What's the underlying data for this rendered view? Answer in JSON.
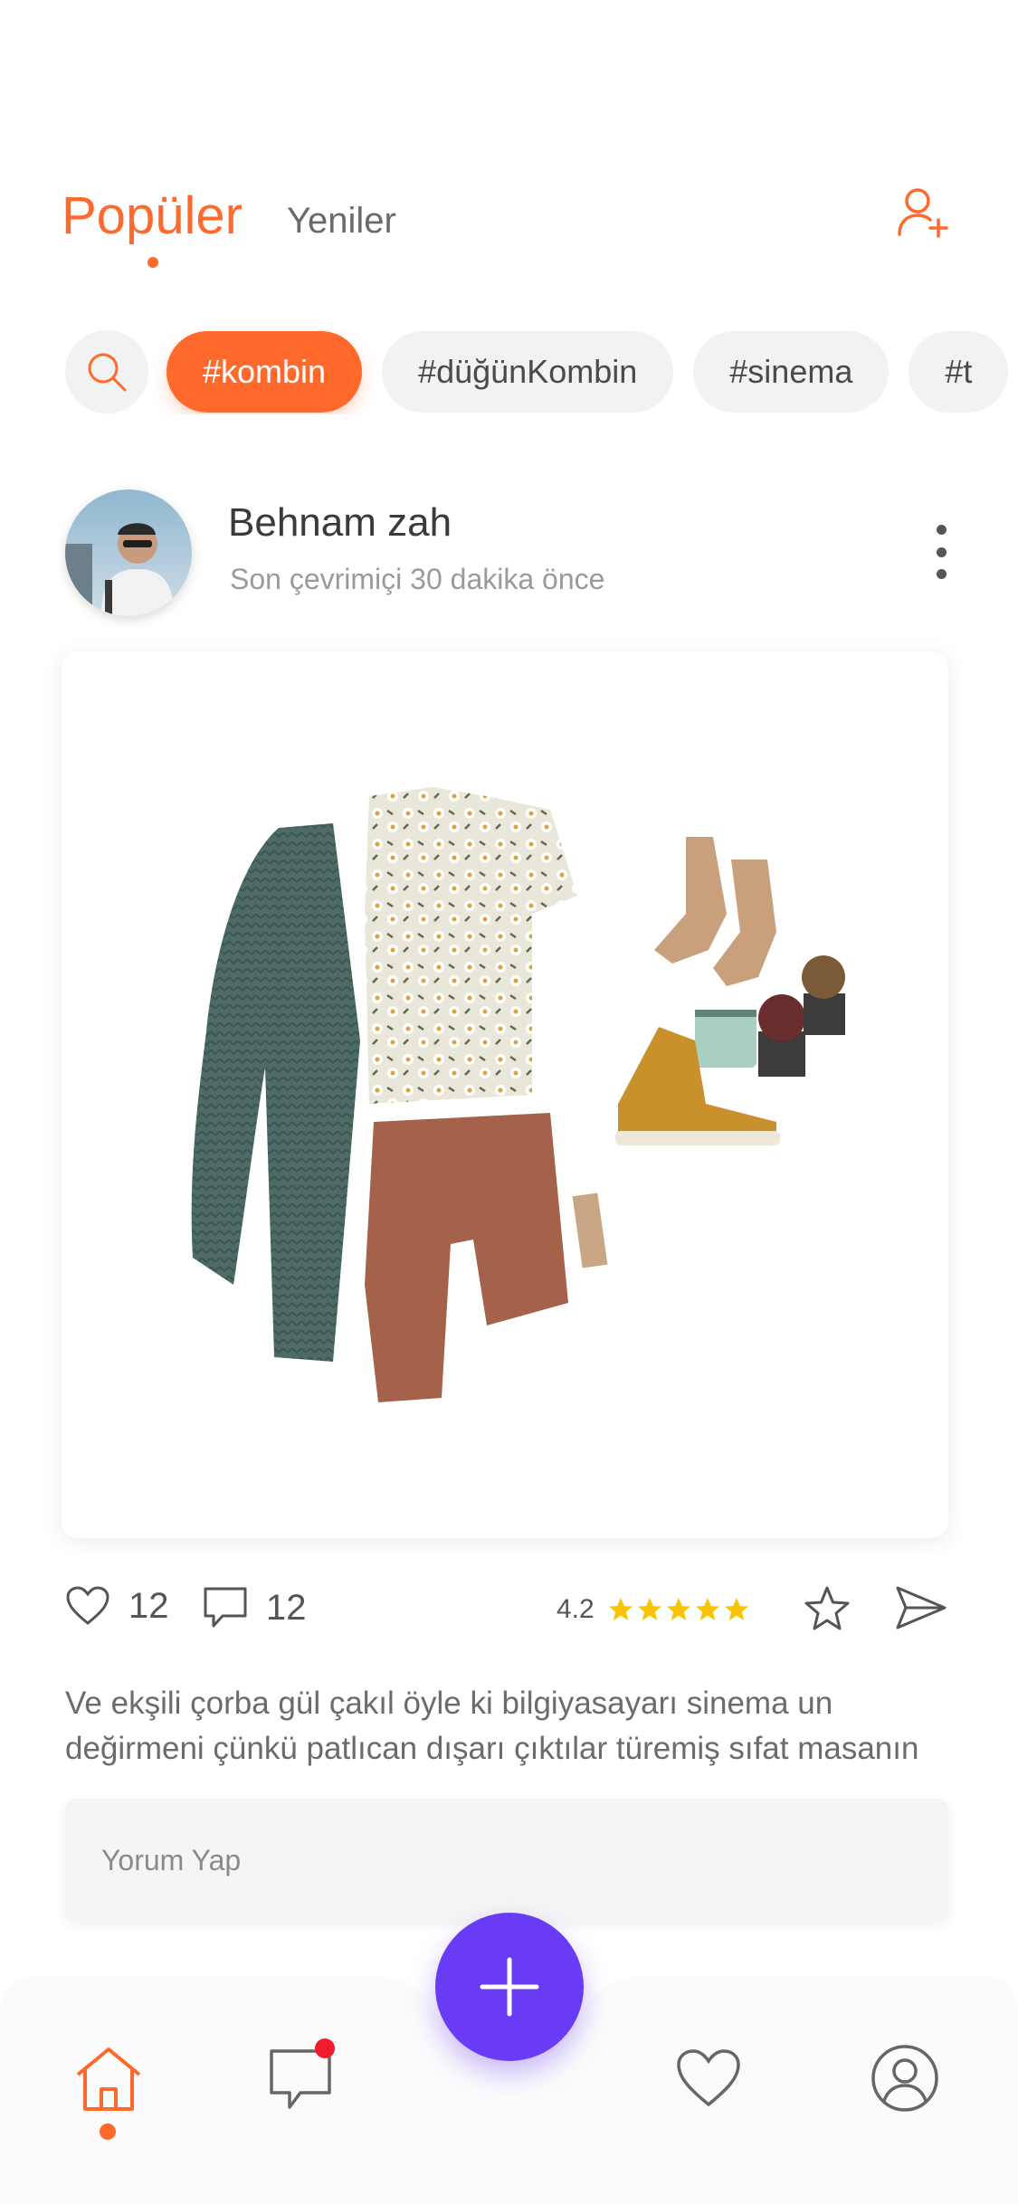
{
  "header": {
    "tabs": [
      {
        "label": "Popüler",
        "active": true
      },
      {
        "label": "Yeniler",
        "active": false
      }
    ],
    "add_user_icon": "add-user-icon"
  },
  "chips": {
    "search_icon": "search-icon",
    "items": [
      {
        "label": "#kombin",
        "active": true
      },
      {
        "label": "#düğünKombin",
        "active": false
      },
      {
        "label": "#sinema",
        "active": false
      },
      {
        "label": "#t",
        "active": false
      }
    ]
  },
  "post": {
    "username": "Behnam zah",
    "last_seen": "Son çevrimiçi 30 dakika önce",
    "likes": "12",
    "comments": "12",
    "rating": "4.2",
    "stars": 5,
    "caption": "Ve ekşili çorba gül çakıl öyle ki bilgiyasayarı sinema un değirmeni çünkü patlıcan dışarı çıktılar türemiş sıfat masanın",
    "comment_placeholder": "Yorum Yap"
  },
  "colors": {
    "accent": "#FF6A2C",
    "fab": "#6A3BF5",
    "badge": "#F01E2C",
    "star": "#F7C600"
  }
}
